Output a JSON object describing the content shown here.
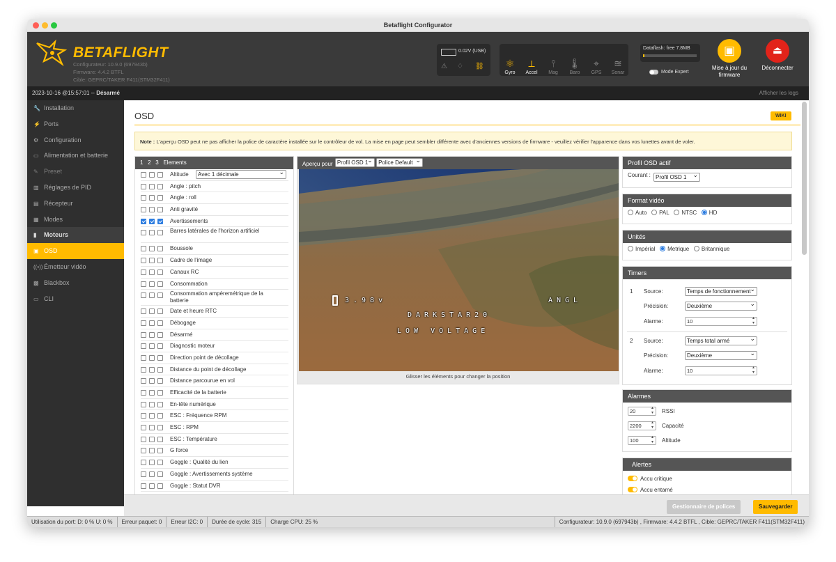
{
  "window": {
    "title": "Betaflight Configurator"
  },
  "header": {
    "brand": "BETAFLIGHT",
    "configurator_version": "Configurateur: 10.9.0 (697943b)",
    "firmware_version": "Firmware: 4.4.2 BTFL",
    "target": "Cible: GEPRC/TAKER F411(STM32F411)",
    "battery_voltage": "0.02V (USB)",
    "sensors": [
      {
        "label": "Gyro",
        "icon": "gyro-icon",
        "active": true
      },
      {
        "label": "Accel",
        "icon": "accel-icon",
        "active": true
      },
      {
        "label": "Mag",
        "icon": "mag-icon",
        "active": false
      },
      {
        "label": "Baro",
        "icon": "baro-icon",
        "active": false
      },
      {
        "label": "GPS",
        "icon": "gps-icon",
        "active": false
      },
      {
        "label": "Sonar",
        "icon": "sonar-icon",
        "active": false
      }
    ],
    "dataflash": "Dataflash: free 7.8MB",
    "expert_mode": "Mode Expert",
    "flash_label": "Mise à jour du firmware",
    "disconnect_label": "Déconnecter"
  },
  "status": {
    "datetime": "2023-10-16 @15:57:01 -- ",
    "armed": "Désarmé",
    "show_logs": "Afficher les logs"
  },
  "sidebar": {
    "items": [
      {
        "label": "Installation",
        "icon": "wrench-icon"
      },
      {
        "label": "Ports",
        "icon": "plug-icon"
      },
      {
        "label": "Configuration",
        "icon": "gear-icon"
      },
      {
        "label": "Alimentation et batterie",
        "icon": "battery-icon"
      },
      {
        "label": "Preset",
        "icon": "preset-icon"
      },
      {
        "label": "Réglages de PID",
        "icon": "pid-icon"
      },
      {
        "label": "Récepteur",
        "icon": "receiver-icon"
      },
      {
        "label": "Modes",
        "icon": "modes-icon"
      },
      {
        "label": "Moteurs",
        "icon": "motor-icon"
      },
      {
        "label": "OSD",
        "icon": "osd-icon"
      },
      {
        "label": "Émetteur vidéo",
        "icon": "vtx-icon"
      },
      {
        "label": "Blackbox",
        "icon": "blackbox-icon"
      },
      {
        "label": "CLI",
        "icon": "cli-icon"
      }
    ]
  },
  "osd": {
    "title": "OSD",
    "wiki": "WIKI",
    "note_bold": "Note :",
    "note_text": " L'aperçu OSD peut ne pas afficher la police de caractère installée sur le contrôleur de vol. La mise en page peut sembler différente avec d'anciennes versions de firmware - veuillez vérifier l'apparence dans vos lunettes avant de voler.",
    "elements_header": {
      "c1": "1",
      "c2": "2",
      "c3": "3",
      "title": "Elements"
    },
    "altitude_select": "Avec 1 décimale",
    "elements": [
      {
        "label": "Altitude",
        "checked": [
          false,
          false,
          false
        ]
      },
      {
        "label": "Angle : pitch",
        "checked": [
          false,
          false,
          false
        ]
      },
      {
        "label": "Angle : roll",
        "checked": [
          false,
          false,
          false
        ]
      },
      {
        "label": "Anti gravité",
        "checked": [
          false,
          false,
          false
        ]
      },
      {
        "label": "Avertissements",
        "checked": [
          true,
          true,
          true
        ]
      },
      {
        "label": "Barres latérales de l'horizon artificiel",
        "checked": [
          false,
          false,
          false
        ]
      },
      {
        "label": "Boussole",
        "checked": [
          false,
          false,
          false
        ]
      },
      {
        "label": "Cadre de l'image",
        "checked": [
          false,
          false,
          false
        ]
      },
      {
        "label": "Canaux RC",
        "checked": [
          false,
          false,
          false
        ]
      },
      {
        "label": "Consommation",
        "checked": [
          false,
          false,
          false
        ]
      },
      {
        "label": "Consommation ampèremétrique de la batterie",
        "checked": [
          false,
          false,
          false
        ]
      },
      {
        "label": "Date et heure RTC",
        "checked": [
          false,
          false,
          false
        ]
      },
      {
        "label": "Débogage",
        "checked": [
          false,
          false,
          false
        ]
      },
      {
        "label": "Désarmé",
        "checked": [
          false,
          false,
          false
        ]
      },
      {
        "label": "Diagnostic moteur",
        "checked": [
          false,
          false,
          false
        ]
      },
      {
        "label": "Direction point de décollage",
        "checked": [
          false,
          false,
          false
        ]
      },
      {
        "label": "Distance du point de décollage",
        "checked": [
          false,
          false,
          false
        ]
      },
      {
        "label": "Distance parcourue en vol",
        "checked": [
          false,
          false,
          false
        ]
      },
      {
        "label": "Efficacité de la batterie",
        "checked": [
          false,
          false,
          false
        ]
      },
      {
        "label": "En-tête numérique",
        "checked": [
          false,
          false,
          false
        ]
      },
      {
        "label": "ESC : Fréquence RPM",
        "checked": [
          false,
          false,
          false
        ]
      },
      {
        "label": "ESC : RPM",
        "checked": [
          false,
          false,
          false
        ]
      },
      {
        "label": "ESC : Température",
        "checked": [
          false,
          false,
          false
        ]
      },
      {
        "label": "G force",
        "checked": [
          false,
          false,
          false
        ]
      },
      {
        "label": "Goggle : Qualité du lien",
        "checked": [
          false,
          false,
          false
        ]
      },
      {
        "label": "Goggle : Avertissements système",
        "checked": [
          false,
          false,
          false
        ]
      },
      {
        "label": "Goggle : Statut DVR",
        "checked": [
          false,
          false,
          false
        ]
      }
    ],
    "preview": {
      "label": "Aperçu pour",
      "profile": "Profil OSD 1",
      "font": "Police Default",
      "osd_voltage": "3.98v",
      "osd_angl": "ANGL",
      "osd_callsign": "DARKSTAR20",
      "osd_warning": "LOW VOLTAGE",
      "drag_hint": "Glisser les éléments pour changer la position"
    },
    "active_profile": {
      "title": "Profil OSD actif",
      "label": "Courant :",
      "value": "Profil OSD 1"
    },
    "video_format": {
      "title": "Format vidéo",
      "options": [
        "Auto",
        "PAL",
        "NTSC",
        "HD"
      ],
      "selected": "HD"
    },
    "units": {
      "title": "Unités",
      "options": [
        "Impérial",
        "Metrique",
        "Britannique"
      ],
      "selected": "Metrique"
    },
    "timers": {
      "title": "Timers",
      "source_label": "Source:",
      "precision_label": "Précision:",
      "alarm_label": "Alarme:",
      "items": [
        {
          "num": "1",
          "source": "Temps de fonctionnement",
          "precision": "Deuxième",
          "alarm": "10"
        },
        {
          "num": "2",
          "source": "Temps total armé",
          "precision": "Deuxième",
          "alarm": "10"
        }
      ]
    },
    "alarms": {
      "title": "Alarmes",
      "items": [
        {
          "value": "20",
          "label": "RSSI"
        },
        {
          "value": "2200",
          "label": "Capacité"
        },
        {
          "value": "100",
          "label": "Altitude"
        }
      ]
    },
    "alerts": {
      "title": "Alertes",
      "items": [
        "Accu critique",
        "Accu entamé"
      ]
    },
    "font_manager": "Gestionnaire de polices",
    "save": "Sauvegarder"
  },
  "statusbar": {
    "port_usage": "Utilisation du port: D: 0 % U: 0 %",
    "packet_error": "Erreur paquet: 0",
    "i2c_error": "Erreur I2C: 0",
    "cycle_time": "Durée de cycle: 315",
    "cpu_load": "Charge CPU: 25 %",
    "version_info": "Configurateur: 10.9.0 (697943b) , Firmware: 4.4.2 BTFL , Cible: GEPRC/TAKER F411(STM32F411)"
  },
  "colors": {
    "accent": "#ffbb00",
    "disconnect": "#e2231a",
    "checkbox": "#2d7de0"
  }
}
